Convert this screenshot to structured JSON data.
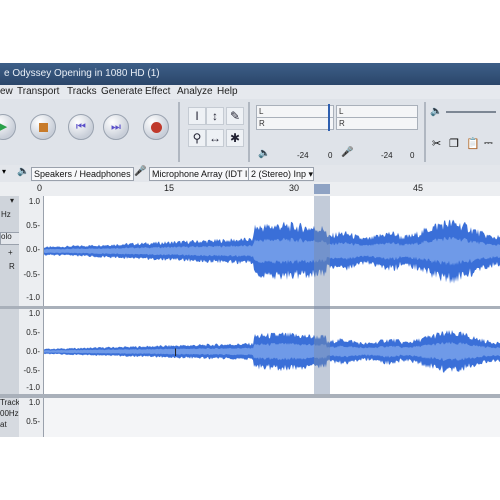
{
  "window": {
    "title": "e Odyssey Opening in 1080 HD (1)"
  },
  "menu": {
    "items": [
      "ew",
      "Transport",
      "Tracks",
      "Generate",
      "Effect",
      "Analyze",
      "Help"
    ]
  },
  "meters": {
    "record_L": "L",
    "record_R": "R",
    "play_L": "L",
    "play_R": "R",
    "record_tick_a": "-24",
    "record_tick_b": "0",
    "play_tick_a": "-24",
    "play_tick_b": "0"
  },
  "device": {
    "output": "Speakers / Headphones",
    "input": "Microphone Array (IDT I",
    "channels": "2 (Stereo) Inp"
  },
  "ruler": {
    "labels": [
      "0",
      "15",
      "30",
      "45"
    ]
  },
  "track1": {
    "ctrl_labels": [
      "Hz",
      "olo",
      "R"
    ],
    "scale": [
      "1.0",
      "0.5-",
      "0.0-",
      "-0.5-",
      "-1.0"
    ]
  },
  "track2": {
    "scale": [
      "1.0",
      "0.5-",
      "0.0-",
      "-0.5-",
      "-1.0"
    ]
  },
  "track3": {
    "ctrl_labels": [
      "Track",
      "00Hz",
      "at"
    ],
    "scale": [
      "1.0",
      "0.5-"
    ]
  },
  "colors": {
    "waveform": "#3a6fd8",
    "waveform_rms": "#6f9ae8",
    "selection": "#8899b3",
    "play": "#2aa14a",
    "record": "#c0392b"
  }
}
